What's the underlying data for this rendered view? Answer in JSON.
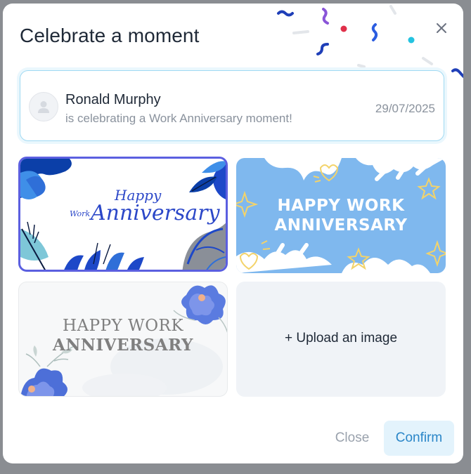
{
  "modal": {
    "title": "Celebrate a moment",
    "close_icon": "close-icon"
  },
  "celebrant": {
    "name": "Ronald Murphy",
    "message": "is celebrating a Work Anniversary moment!",
    "date": "29/07/2025",
    "avatar_icon": "user-placeholder-icon"
  },
  "cards": [
    {
      "line1": "Happy",
      "line2a": "Work",
      "line2b": "Anniversary",
      "selected": true,
      "accent": "#5b5fe0"
    },
    {
      "line1": "HAPPY WORK",
      "line2": "ANNIVERSARY"
    },
    {
      "line1": "HAPPY WORK",
      "line2": "ANNIVERSARY"
    },
    {
      "label": "+ Upload an image"
    }
  ],
  "footer": {
    "close_label": "Close",
    "confirm_label": "Confirm"
  },
  "colors": {
    "selected_border": "#5b5fe0",
    "confirm_text": "#2a86c8",
    "confirm_bg": "#e3f3fc",
    "celebrant_border": "#9fd9f2"
  }
}
